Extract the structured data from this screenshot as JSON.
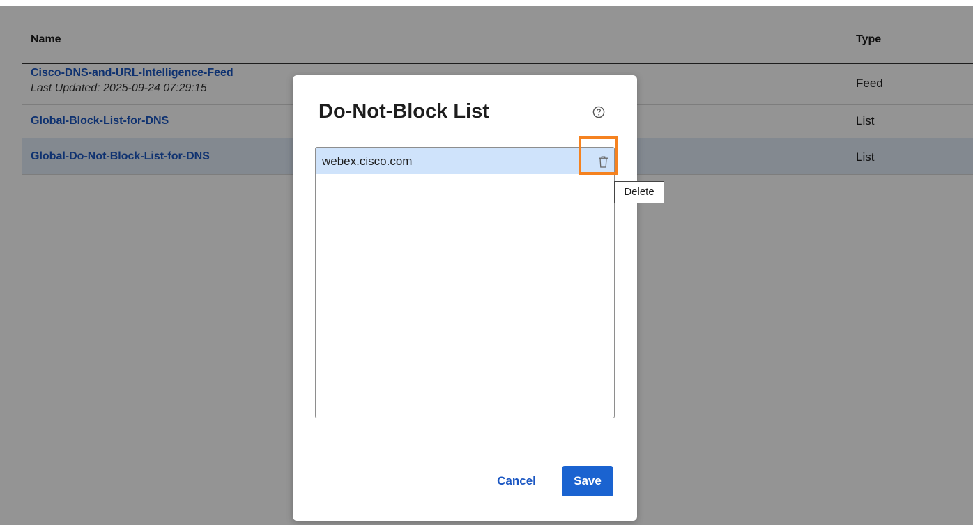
{
  "table": {
    "headers": {
      "name": "Name",
      "type": "Type"
    },
    "rows": [
      {
        "name": "Cisco-DNS-and-URL-Intelligence-Feed",
        "subtitle": "Last Updated: 2025-09-24 07:29:15",
        "type": "Feed"
      },
      {
        "name": "Global-Block-List-for-DNS",
        "type": "List"
      },
      {
        "name": "Global-Do-Not-Block-List-for-DNS",
        "type": "List",
        "selected": true
      }
    ]
  },
  "modal": {
    "title": "Do-Not-Block List",
    "help_icon": "question-circle-icon",
    "list_items": [
      "webex.cisco.com"
    ],
    "delete_icon": "trash-icon",
    "delete_tooltip": "Delete",
    "highlight_color": "#f58220",
    "cancel_label": "Cancel",
    "save_label": "Save"
  },
  "colors": {
    "link": "#1a56c2",
    "primary_button": "#1a63d0",
    "selected_row": "#e2ecf8",
    "selected_item": "#cfe3fb"
  }
}
